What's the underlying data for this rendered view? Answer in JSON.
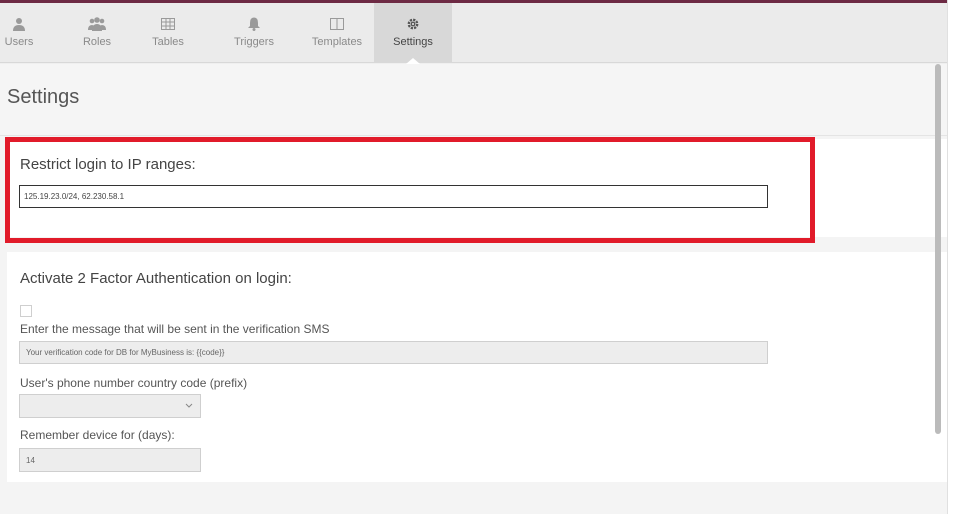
{
  "nav": {
    "items": [
      {
        "label": "Users",
        "icon": "user-icon"
      },
      {
        "label": "Roles",
        "icon": "roles-icon"
      },
      {
        "label": "Tables",
        "icon": "table-icon"
      },
      {
        "label": "Triggers",
        "icon": "bell-icon"
      },
      {
        "label": "Templates",
        "icon": "template-icon"
      },
      {
        "label": "Settings",
        "icon": "gear-icon",
        "active": true
      }
    ]
  },
  "page": {
    "title": "Settings"
  },
  "ip_section": {
    "label": "Restrict login to IP ranges:",
    "value": "125.19.23.0/24, 62.230.58.1"
  },
  "twofa_section": {
    "title": "Activate 2 Factor Authentication on login:",
    "sms_label": "Enter the message that will be sent in the verification SMS",
    "sms_value": "Your verification code for DB for MyBusiness is: {{code}}",
    "prefix_label": "User's phone number country code (prefix)",
    "prefix_value": "",
    "remember_label": "Remember device for (days):",
    "remember_value": "14"
  },
  "colors": {
    "highlight": "#e11b2a",
    "topline": "#6d2a44"
  }
}
